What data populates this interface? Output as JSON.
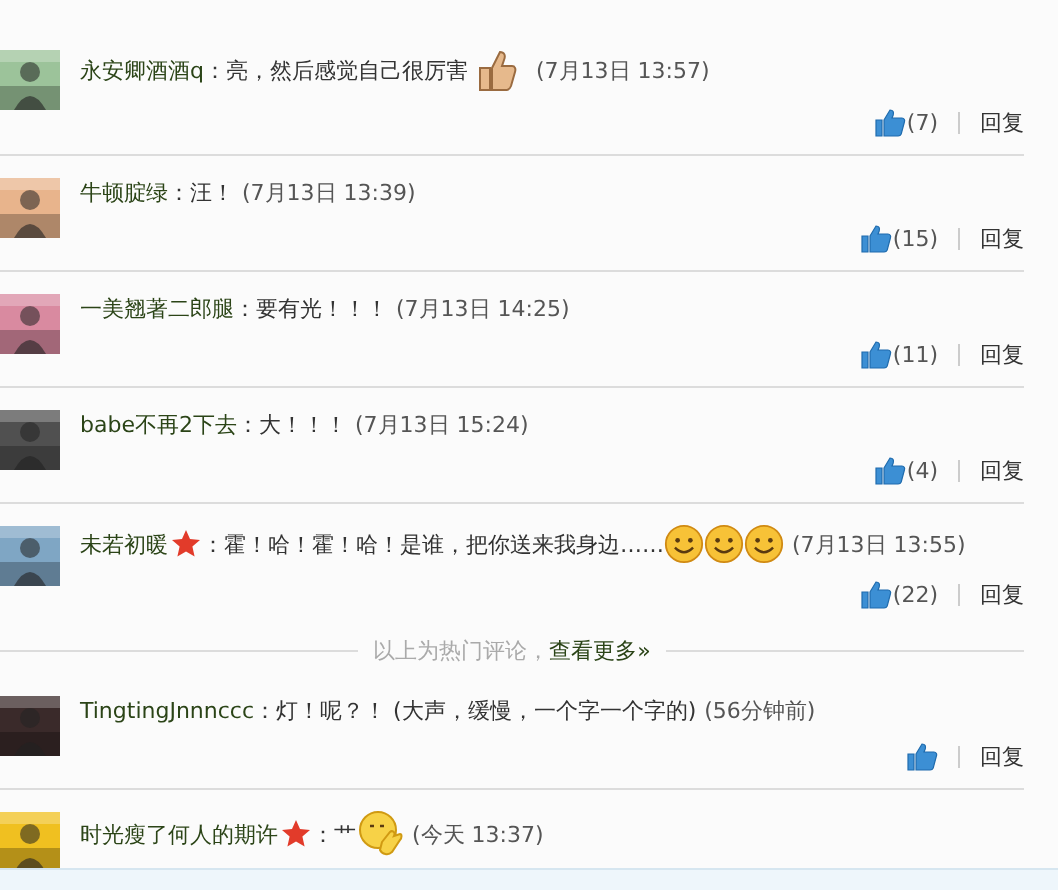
{
  "hot_comments": [
    {
      "user": "永安卿酒酒q",
      "vip": false,
      "text": "：亮，然后感觉自己很厉害",
      "emoticons": [
        {
          "kind": "thumb"
        }
      ],
      "time": "(7月13日 13:57)",
      "likes": "(7)",
      "reply": "回复",
      "avatar": {
        "kind": "picture"
      }
    },
    {
      "user": "牛顿腚绿",
      "vip": false,
      "text": "：汪！",
      "time": "(7月13日 13:39)",
      "likes": "(15)",
      "reply": "回复",
      "avatar": {
        "kind": "picture"
      }
    },
    {
      "user": "一美翘著二郎腿",
      "vip": false,
      "text": "：要有光！！！",
      "time": "(7月13日 14:25)",
      "likes": "(11)",
      "reply": "回复",
      "avatar": {
        "kind": "picture"
      }
    },
    {
      "user": "babe不再2下去",
      "vip": false,
      "text": "：大！！！",
      "time": "(7月13日 15:24)",
      "likes": "(4)",
      "reply": "回复",
      "avatar": {
        "kind": "picture"
      }
    },
    {
      "user": "未若初暖",
      "vip": true,
      "text": "：霍！哈！霍！哈！是谁，把你送来我身边……",
      "emoticons": [
        {
          "kind": "smiley"
        },
        {
          "kind": "smiley"
        },
        {
          "kind": "smiley"
        }
      ],
      "time": "(7月13日 13:55)",
      "likes": "(22)",
      "reply": "回复",
      "avatar": {
        "kind": "picture"
      }
    }
  ],
  "hot_divider": {
    "text": "以上为热门评论，",
    "link": "查看更多»"
  },
  "comments": [
    {
      "user": "TingtingJnnnccc",
      "vip": false,
      "text": "：灯！呢？！ (大声，缓慢，一个字一个字的)",
      "time": "(56分钟前)",
      "reply": "回复",
      "avatar": {
        "kind": "picture"
      }
    },
    {
      "user": "时光瘦了何人的期许",
      "vip": true,
      "text": "：艹",
      "emoticons": [
        {
          "kind": "wave"
        }
      ],
      "time": "(今天 13:37)",
      "avatar": {
        "kind": "picture"
      }
    }
  ]
}
